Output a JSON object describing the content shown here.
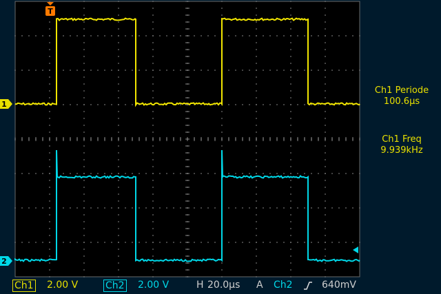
{
  "screen": {
    "trigger_marker": "T",
    "channel_markers": [
      "1",
      "2"
    ]
  },
  "channels": [
    {
      "name": "Ch1",
      "color": "#f2e600",
      "scale": "2.00 V"
    },
    {
      "name": "Ch2",
      "color": "#00d8e8",
      "scale": "2.00 V"
    }
  ],
  "measurements": [
    {
      "label": "Ch1 Periode",
      "value": "100.6µs"
    },
    {
      "label": "Ch1 Freq",
      "value": "9.939kHz"
    }
  ],
  "status_bar": {
    "ch1_label": "Ch1",
    "ch1_scale": "2.00 V",
    "ch2_label": "Ch2",
    "ch2_scale": "2.00 V",
    "h_label": "H",
    "timebase": "20.0µs",
    "a_label": "A",
    "trigger_source": "Ch2",
    "trigger_slope_icon": "rising-edge-icon",
    "trigger_level": "640mV"
  },
  "chart_data": {
    "type": "line",
    "xlabel": "",
    "ylabel": "",
    "x_divisions": 10,
    "y_divisions": 8,
    "grid": true,
    "series": [
      {
        "name": "Ch1",
        "color": "#f2e600",
        "x_div": [
          0,
          1.2,
          1.2,
          3.5,
          3.5,
          6.0,
          6.0,
          8.5,
          8.5,
          10
        ],
        "y_level": [
          0,
          0,
          1,
          1,
          0,
          0,
          1,
          1,
          0,
          0
        ]
      },
      {
        "name": "Ch2",
        "color": "#00d8e8",
        "x_div": [
          0,
          1.2,
          1.2,
          3.5,
          3.5,
          6.0,
          6.0,
          8.5,
          8.5,
          10
        ],
        "y_level": [
          0,
          0,
          1,
          1,
          0,
          0,
          1,
          1,
          0,
          0
        ]
      }
    ]
  }
}
